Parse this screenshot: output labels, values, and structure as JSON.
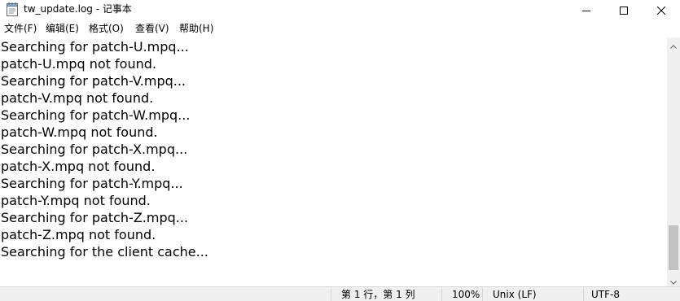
{
  "window": {
    "title": "tw_update.log - 记事本"
  },
  "menu": [
    "文件(F)",
    "编辑(E)",
    "格式(O)",
    "查看(V)",
    "帮助(H)"
  ],
  "editor": {
    "lines": [
      "Searching for patch-U.mpq...",
      "patch-U.mpq not found.",
      "Searching for patch-V.mpq...",
      "patch-V.mpq not found.",
      "Searching for patch-W.mpq...",
      "patch-W.mpq not found.",
      "Searching for patch-X.mpq...",
      "patch-X.mpq not found.",
      "Searching for patch-Y.mpq...",
      "patch-Y.mpq not found.",
      "Searching for patch-Z.mpq...",
      "patch-Z.mpq not found.",
      "Searching for the client cache..."
    ]
  },
  "scrollbar": {
    "position": 0.92
  },
  "status": {
    "position": "第 1 行，第 1 列",
    "zoom": "100%",
    "line_ending": "Unix (LF)",
    "encoding": "UTF-8"
  },
  "icons": {
    "app": "notepad-icon",
    "minimize": "minimize-icon",
    "maximize": "maximize-icon",
    "close": "close-icon"
  }
}
